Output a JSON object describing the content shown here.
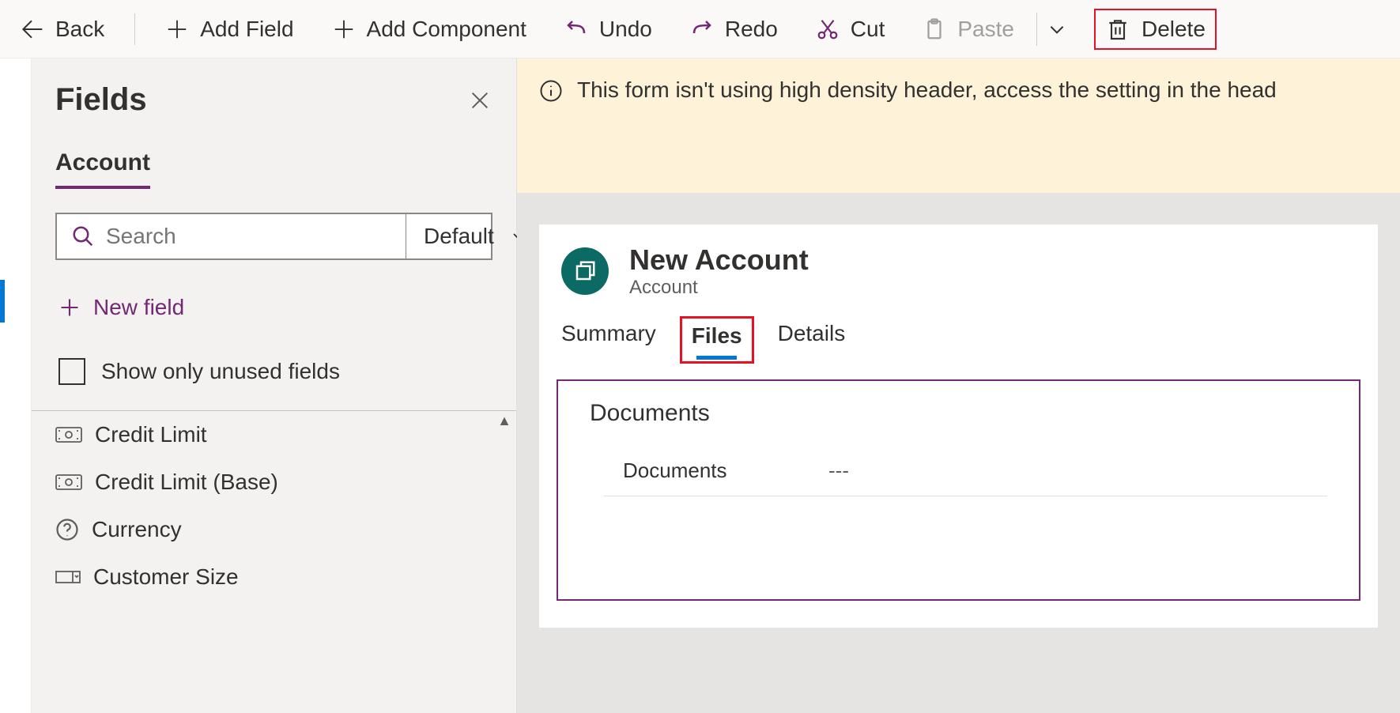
{
  "toolbar": {
    "back": "Back",
    "add_field": "Add Field",
    "add_component": "Add Component",
    "undo": "Undo",
    "redo": "Redo",
    "cut": "Cut",
    "paste": "Paste",
    "delete": "Delete"
  },
  "fields_panel": {
    "title": "Fields",
    "entity_tab": "Account",
    "search_placeholder": "Search",
    "filter_label": "Default",
    "new_field": "New field",
    "checkbox_label": "Show only unused fields",
    "items": [
      {
        "icon": "currency",
        "label": "Credit Limit"
      },
      {
        "icon": "currency",
        "label": "Credit Limit (Base)"
      },
      {
        "icon": "question",
        "label": "Currency"
      },
      {
        "icon": "box",
        "label": "Customer Size"
      }
    ]
  },
  "banner": {
    "text": "This form isn't using high density header, access the setting in the head"
  },
  "form": {
    "title": "New Account",
    "subtitle": "Account",
    "tabs": [
      {
        "label": "Summary",
        "active": false
      },
      {
        "label": "Files",
        "active": true
      },
      {
        "label": "Details",
        "active": false
      }
    ],
    "documents": {
      "section_title": "Documents",
      "row_label": "Documents",
      "row_value": "---"
    }
  }
}
